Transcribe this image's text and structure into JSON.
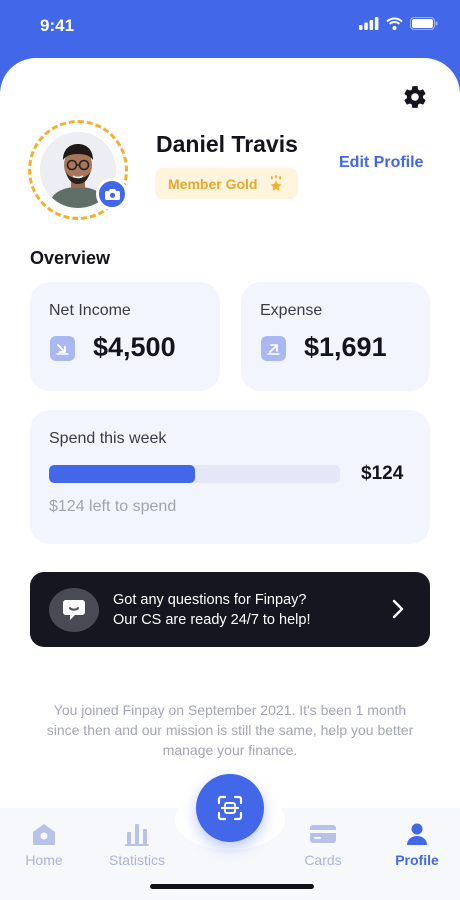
{
  "status_bar": {
    "time": "9:41"
  },
  "profile": {
    "name": "Daniel Travis",
    "membership": "Member Gold",
    "edit_label": "Edit Profile"
  },
  "overview": {
    "title": "Overview",
    "net_income": {
      "label": "Net Income",
      "value": "$4,500"
    },
    "expense": {
      "label": "Expense",
      "value": "$1,691"
    }
  },
  "spend": {
    "title": "Spend this week",
    "amount": "$124",
    "progress_fraction": 0.5,
    "left_text": "$124 left to spend"
  },
  "help": {
    "line1": "Got any questions for Finpay?",
    "line2": "Our CS are ready 24/7 to help!"
  },
  "join_text": "You joined Finpay on September 2021. It's been 1 month since then and our mission is still the same, help you better manage your finance.",
  "tabs": [
    {
      "label": "Home",
      "icon": "home-icon"
    },
    {
      "label": "Statistics",
      "icon": "statistics-icon"
    },
    {
      "label": "Cards",
      "icon": "card-icon"
    },
    {
      "label": "Profile",
      "icon": "profile-icon",
      "active": true
    }
  ],
  "colors": {
    "accent": "#4267e9",
    "gold": "#f4b02d",
    "dark": "#161620"
  }
}
